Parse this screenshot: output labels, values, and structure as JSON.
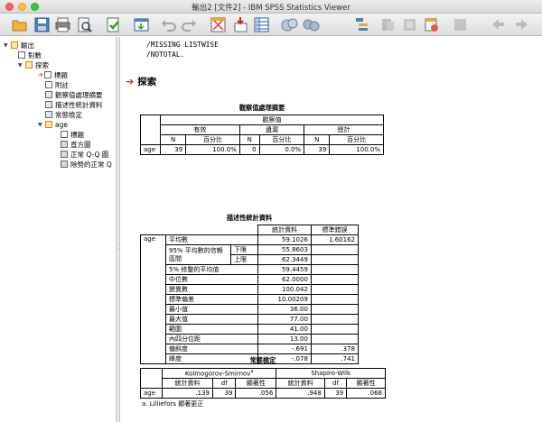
{
  "window": {
    "title": "輸出2 [文件2] - IBM SPSS Statistics Viewer"
  },
  "toolbar": {
    "items": [
      "open-icon",
      "save-icon",
      "print-icon",
      "print-preview-icon",
      "export-icon",
      "goto-data-icon",
      "undo-icon",
      "redo-icon",
      "goto-case-icon",
      "insert-output-icon",
      "designate-window-icon",
      "variables-icon",
      "collapse-icon",
      "expand-icon",
      "show-icon",
      "hide-icon",
      "header-icon",
      "title-icon",
      "text-icon",
      "previous-icon",
      "next-icon"
    ]
  },
  "tree": {
    "root": "輸出",
    "log": "對數",
    "explore": "探索",
    "items": [
      "標題",
      "附註",
      "觀察值處理摘要",
      "描述性統計資料",
      "常態檢定"
    ],
    "age": "age",
    "age_items": [
      "標題",
      "直方圖",
      "正常 Q-Q 圖",
      "除勢的正常 Q"
    ]
  },
  "syntax": [
    "/MISSING LISTWISE",
    "/NOTOTAL."
  ],
  "section_title": "探索",
  "case_summary": {
    "title": "觀察值處理摘要",
    "group_header": "觀察值",
    "col_groups": [
      "有效",
      "遺漏",
      "總計"
    ],
    "sub_headers": [
      "N",
      "百分比",
      "N",
      "百分比",
      "N",
      "百分比"
    ],
    "row_label": "age",
    "values": [
      "39",
      "100.0%",
      "0",
      "0.0%",
      "39",
      "100.0%"
    ]
  },
  "descriptives": {
    "title": "描述性統計資料",
    "headers": [
      "統計資料",
      "標準錯誤"
    ],
    "var": "age",
    "rows": [
      {
        "label": "平均數",
        "stat": "59.1026",
        "se": "1.60162"
      },
      {
        "label": "95% 平均數的信賴區間",
        "sub": "下限",
        "stat": "55.8603",
        "se": ""
      },
      {
        "label": "",
        "sub": "上限",
        "stat": "62.3449",
        "se": ""
      },
      {
        "label": "5% 修整的平均值",
        "stat": "59.4459",
        "se": ""
      },
      {
        "label": "中位數",
        "stat": "62.0000",
        "se": ""
      },
      {
        "label": "變異數",
        "stat": "100.042",
        "se": ""
      },
      {
        "label": "標準偏差",
        "stat": "10.00209",
        "se": ""
      },
      {
        "label": "最小值",
        "stat": "36.00",
        "se": ""
      },
      {
        "label": "最大值",
        "stat": "77.00",
        "se": ""
      },
      {
        "label": "範圍",
        "stat": "41.00",
        "se": ""
      },
      {
        "label": "內四分位距",
        "stat": "13.00",
        "se": ""
      },
      {
        "label": "偏斜度",
        "stat": "-.691",
        "se": ".378"
      },
      {
        "label": "峰度",
        "stat": "-.078",
        "se": ".741"
      }
    ]
  },
  "normality": {
    "title": "常態檢定",
    "groups": [
      "Kolmogorov-Smirnov",
      "Shapiro-Wilk"
    ],
    "ks_sup": "a",
    "sub_headers": [
      "統計資料",
      "df",
      "顯著性",
      "統計資料",
      "df",
      "顯著性"
    ],
    "row_label": "age",
    "values": [
      ".139",
      "39",
      ".056",
      ".948",
      "39",
      ".068"
    ],
    "footnote": "a. Lilliefors 顯著更正"
  },
  "colors": {
    "accent_arrow": "#e02020",
    "close": "#fc605c",
    "min": "#fdbc40",
    "max": "#34c84a"
  }
}
